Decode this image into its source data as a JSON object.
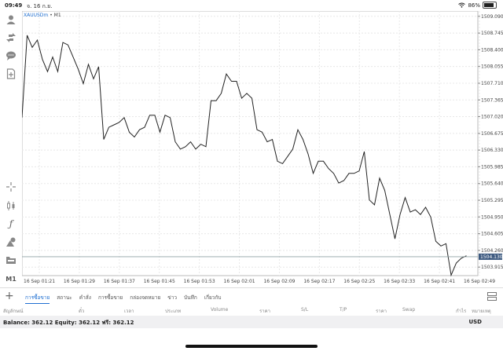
{
  "status_bar": {
    "time": "09:49",
    "date": "จ. 16 ก.ย.",
    "battery": "86%",
    "battery_level": 0.86
  },
  "chart": {
    "symbol": "XAUUSDm",
    "timeframe": "M1",
    "current_price": "1504.130",
    "current_price_value": 1504.13,
    "y_ticks": [
      "1509.090",
      "1508.745",
      "1508.400",
      "1508.055",
      "1507.710",
      "1507.365",
      "1507.020",
      "1506.675",
      "1506.330",
      "1505.985",
      "1505.640",
      "1505.295",
      "1504.950",
      "1504.605",
      "1504.260",
      "1503.915"
    ],
    "x_ticks": [
      "16 Sep 01:21",
      "16 Sep 01:29",
      "16 Sep 01:37",
      "16 Sep 01:45",
      "16 Sep 01:53",
      "16 Sep 02:01",
      "16 Sep 02:09",
      "16 Sep 02:17",
      "16 Sep 02:25",
      "16 Sep 02:33",
      "16 Sep 02:41",
      "16 Sep 02:49"
    ]
  },
  "chart_data": {
    "type": "line",
    "title": "",
    "xlabel": "",
    "ylabel": "",
    "ylim": [
      1503.74,
      1509.2
    ],
    "grid": true,
    "x_start_label": "16 Sep 01:19",
    "values": [
      1507.0,
      1508.7,
      1508.45,
      1508.6,
      1508.2,
      1507.95,
      1508.25,
      1507.95,
      1508.55,
      1508.5,
      1508.25,
      1508.0,
      1507.7,
      1508.1,
      1507.8,
      1508.05,
      1506.55,
      1506.8,
      1506.85,
      1506.9,
      1507.0,
      1506.7,
      1506.6,
      1506.75,
      1506.8,
      1507.05,
      1507.05,
      1506.7,
      1507.05,
      1507.0,
      1506.5,
      1506.35,
      1506.4,
      1506.5,
      1506.35,
      1506.45,
      1506.4,
      1507.35,
      1507.35,
      1507.5,
      1507.9,
      1507.75,
      1507.75,
      1507.4,
      1507.5,
      1507.4,
      1506.75,
      1506.7,
      1506.5,
      1506.55,
      1506.1,
      1506.05,
      1506.2,
      1506.35,
      1506.75,
      1506.55,
      1506.25,
      1505.85,
      1506.1,
      1506.1,
      1505.95,
      1505.85,
      1505.65,
      1505.7,
      1505.85,
      1505.85,
      1505.9,
      1506.3,
      1505.3,
      1505.2,
      1505.75,
      1505.5,
      1505.0,
      1504.5,
      1505.0,
      1505.35,
      1505.05,
      1505.1,
      1505.0,
      1505.15,
      1504.95,
      1504.45,
      1504.35,
      1504.4,
      1503.75,
      1504.0,
      1504.1,
      1504.15
    ]
  },
  "sidebar": {
    "icons": [
      "person-icon",
      "trade-arrows-icon",
      "chat-icon",
      "add-document-icon",
      "crosshair-icon",
      "candlestick-icon",
      "function-icon",
      "objects-icon",
      "folder-icon"
    ],
    "timeframe_label": "M1"
  },
  "toolbar": {
    "tabs": [
      "การซื้อขาย",
      "สถานะ",
      "คำสั่ง",
      "การซื้อขาย",
      "กล่องจดหมาย",
      "ข่าว",
      "บันทึก",
      "เกี่ยวกับ"
    ],
    "active_tab": 0
  },
  "columns": [
    "สัญลักษณ์",
    "ตั๋ว",
    "เวลา",
    "ประเภท",
    "Volume",
    "ราคา",
    "S/L",
    "T/P",
    "ราคา",
    "Swap",
    "กำไร",
    "หมายเหตุ"
  ],
  "balance": {
    "text": "Balance: 362.12 Equity: 362.12 ฟรี: 362.12",
    "currency": "USD"
  }
}
